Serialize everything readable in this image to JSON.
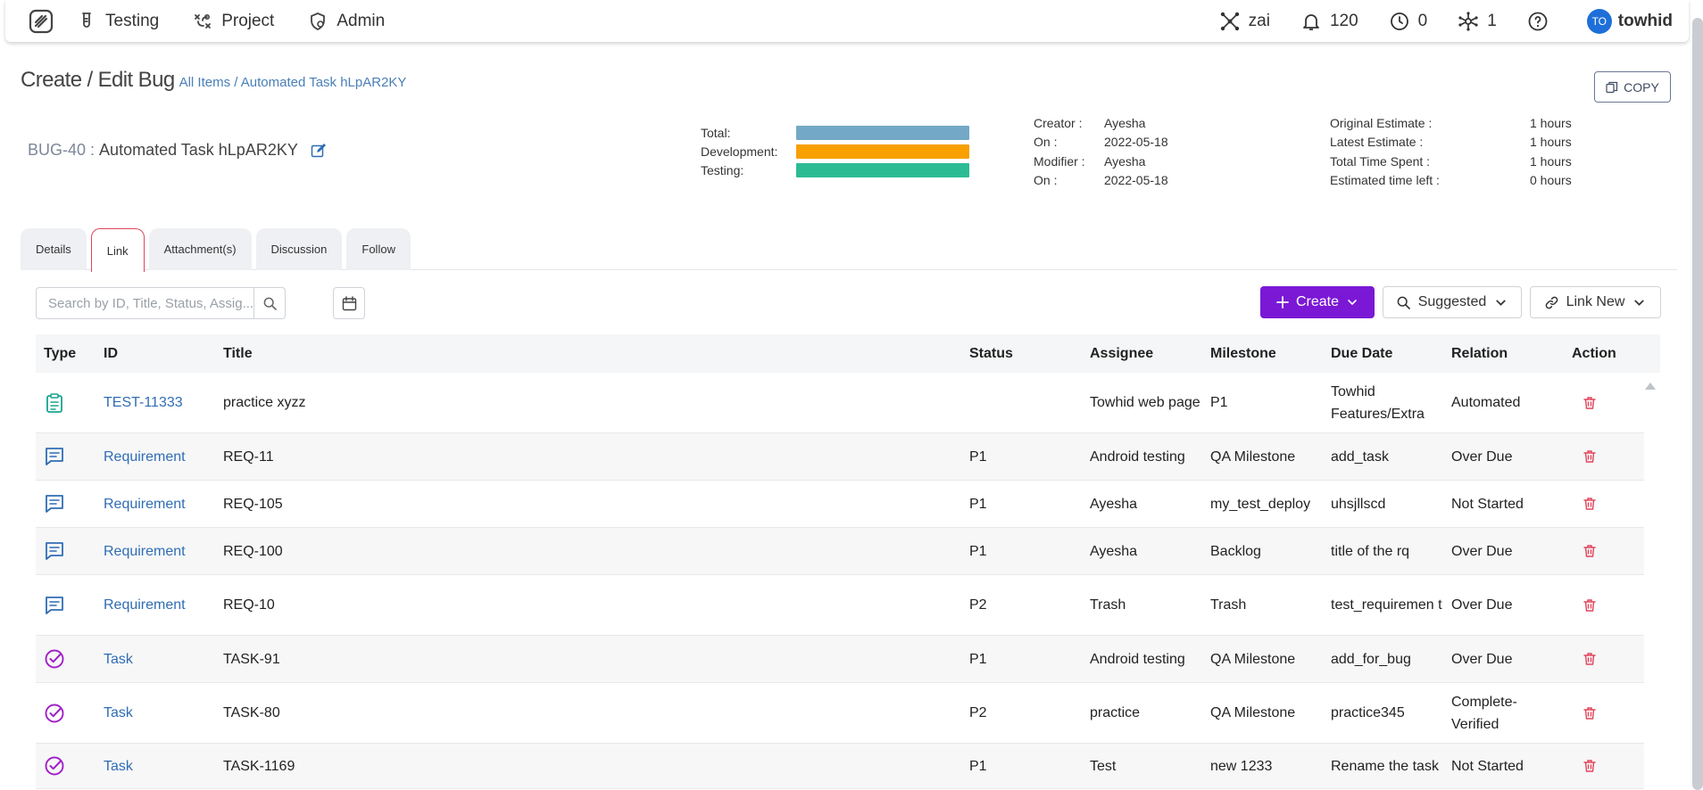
{
  "nav": {
    "items": [
      {
        "label": "Testing",
        "icon": "flask-icon"
      },
      {
        "label": "Project",
        "icon": "workflow-icon"
      },
      {
        "label": "Admin",
        "icon": "shield-gear-icon"
      }
    ],
    "zai": "zai",
    "notifications": "120",
    "clock_count": "0",
    "network_count": "1",
    "avatar_initials": "TO",
    "username": "towhid"
  },
  "header": {
    "title": "Create / Edit Bug",
    "breadcrumb": "All Items / Automated Task hLpAR2KY",
    "copy_label": "COPY",
    "bug_id": "BUG-40",
    "bug_sep": " : ",
    "bug_name": "Automated Task hLpAR2KY"
  },
  "progress": [
    {
      "label": "Total:",
      "color": "#73a9c6"
    },
    {
      "label": "Development:",
      "color": "#f7a000"
    },
    {
      "label": "Testing:",
      "color": "#2cbc94"
    }
  ],
  "meta": {
    "creator_label": "Creator :",
    "creator": "Ayesha",
    "on1_label": "On :",
    "on1": "2022-05-18",
    "modifier_label": "Modifier :",
    "modifier": "Ayesha",
    "on2_label": "On :",
    "on2": "2022-05-18"
  },
  "estimates": {
    "original_label": "Original Estimate :",
    "original": "1 hours",
    "latest_label": "Latest Estimate :",
    "latest": "1 hours",
    "spent_label": "Total Time Spent :",
    "spent": "1 hours",
    "left_label": "Estimated time left :",
    "left": "0 hours"
  },
  "tabs": [
    "Details",
    "Link",
    "Attachment(s)",
    "Discussion",
    "Follow"
  ],
  "active_tab": "Link",
  "toolbar": {
    "search_placeholder": "Search by ID, Title, Status, Assig...",
    "create_label": "Create",
    "suggested_label": "Suggested",
    "link_new_label": "Link New"
  },
  "table": {
    "headers": [
      "Type",
      "ID",
      "Title",
      "Status",
      "Assignee",
      "Milestone",
      "Due Date",
      "Relation",
      "Action"
    ],
    "rows": [
      {
        "type": "test",
        "id": "TEST-11333",
        "title": "practice xyzz",
        "status": "",
        "assignee": "Towhid web page",
        "milestone": "P1",
        "due": "Towhid Features/Extra",
        "relation": "Automated"
      },
      {
        "type": "requirement",
        "id": "Requirement",
        "title": "REQ-11",
        "status": "P1",
        "assignee": "Android testing",
        "milestone": "QA Milestone",
        "due": "add_task",
        "relation": "Over Due"
      },
      {
        "type": "requirement",
        "id": "Requirement",
        "title": "REQ-105",
        "status": "P1",
        "assignee": "Ayesha",
        "milestone": "my_test_deploy",
        "due": "uhsjllscd",
        "relation": "Not Started"
      },
      {
        "type": "requirement",
        "id": "Requirement",
        "title": "REQ-100",
        "status": "P1",
        "assignee": "Ayesha",
        "milestone": "Backlog",
        "due": "title of the rq",
        "relation": "Over Due"
      },
      {
        "type": "requirement",
        "id": "Requirement",
        "title": "REQ-10",
        "status": "P2",
        "assignee": "Trash",
        "milestone": "Trash",
        "due": "test_requiremen t",
        "relation": "Over Due"
      },
      {
        "type": "task",
        "id": "Task",
        "title": "TASK-91",
        "status": "P1",
        "assignee": "Android testing",
        "milestone": "QA Milestone",
        "due": "add_for_bug",
        "relation": "Over Due"
      },
      {
        "type": "task",
        "id": "Task",
        "title": "TASK-80",
        "status": "P2",
        "assignee": "practice",
        "milestone": "QA Milestone",
        "due": "practice345",
        "relation": "Complete-Verified"
      },
      {
        "type": "task",
        "id": "Task",
        "title": "TASK-1169",
        "status": "P1",
        "assignee": "Test",
        "milestone": "new 1233",
        "due": "Rename the task",
        "relation": "Not Started"
      }
    ]
  },
  "colors": {
    "accent": "#7b18d6",
    "link": "#2f6db3",
    "danger": "#e0455a",
    "test_icon": "#1aa38f",
    "req_icon": "#2f6db3",
    "task_icon": "#a020c8"
  }
}
